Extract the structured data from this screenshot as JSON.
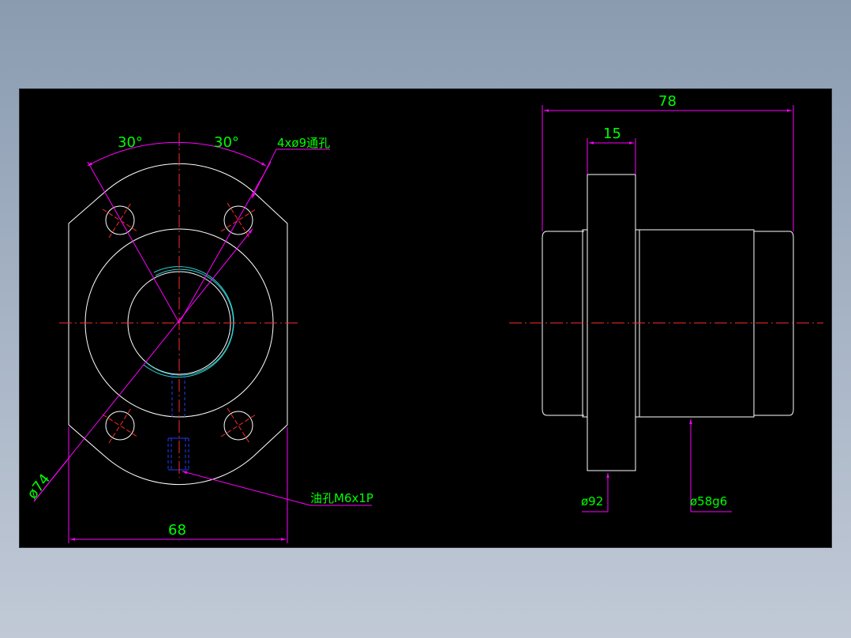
{
  "drawing": {
    "front_view": {
      "angle_left": "30°",
      "angle_right": "30°",
      "hole_note": "4xø9通孔",
      "diameter_pcd": "ø74",
      "width": "68",
      "oil_hole_note": "油孔M6x1P"
    },
    "side_view": {
      "overall_length": "78",
      "flange_thickness": "15",
      "flange_diameter": "ø92",
      "body_diameter": "ø58g6"
    },
    "colors": {
      "outline": "#ffffff",
      "centerline": "#ff2a2a",
      "dimension": "#ff00ff",
      "text": "#00ff00",
      "hidden": "#1f3cff",
      "thread": "#33cccc"
    }
  }
}
